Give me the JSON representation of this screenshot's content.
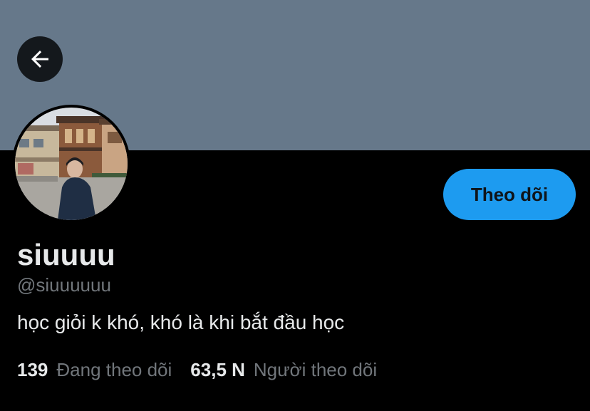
{
  "header": {
    "back_icon": "arrow-left-icon",
    "banner_color": "#66788a"
  },
  "profile": {
    "avatar_description": "profile-photo",
    "display_name": "siuuuu",
    "handle": "@siuuuuuu",
    "bio": "học giỏi k khó, khó là khi bắt đầu học",
    "follow_label": "Theo dõi",
    "accent_color": "#1d9bf0"
  },
  "stats": {
    "following_count": "139",
    "following_label": "Đang theo dõi",
    "followers_count": "63,5 N",
    "followers_label": "Người theo dõi"
  }
}
